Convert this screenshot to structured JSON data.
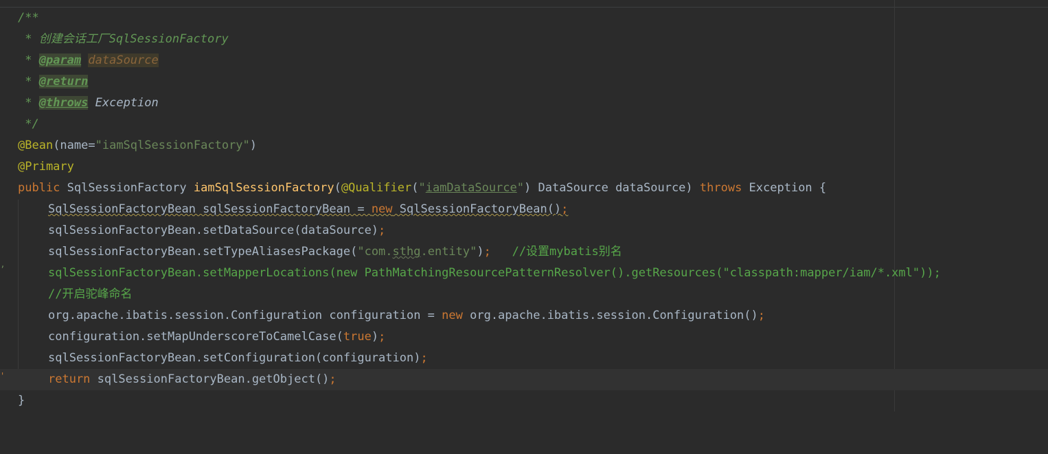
{
  "editor": {
    "language": "java",
    "gutter_marks": {
      "mapper_line_mark": "ʼ",
      "return_line_mark": "'"
    },
    "lines": {
      "l1": "/**",
      "l2_prefix": " * ",
      "l2_text": "创建会话工厂SqlSessionFactory",
      "l3_prefix": " * ",
      "l3_tag": "@param",
      "l3_param": "dataSource",
      "l4_prefix": " * ",
      "l4_tag": "@return",
      "l5_prefix": " * ",
      "l5_tag": "@throws",
      "l5_ref": "Exception",
      "l6": " */",
      "l7_ann": "@Bean",
      "l7_open": "(name=",
      "l7_str": "\"iamSqlSessionFactory\"",
      "l7_close": ")",
      "l8_ann": "@Primary",
      "l9_kw1": "public",
      "l9_type": " SqlSessionFactory ",
      "l9_fn": "iamSqlSessionFactory",
      "l9_open": "(",
      "l9_ann": "@Qualifier",
      "l9_p1": "(",
      "l9_q1": "\"",
      "l9_str": "iamDataSource",
      "l9_q2": "\"",
      "l9_rest": ") DataSource dataSource) ",
      "l9_kw2": "throws",
      "l9_end": " Exception {",
      "l10_decl": "SqlSessionFactoryBean sqlSessionFactoryBean = ",
      "l10_new": "new",
      "l10_ctor": " SqlSessionFactoryBean()",
      "l10_semi": ";",
      "l11_code": "sqlSessionFactoryBean.setDataSource(dataSource)",
      "l11_semi": ";",
      "l12_code": "sqlSessionFactoryBean.setTypeAliasesPackage(",
      "l12_str1": "\"com.",
      "l12_str2": "sthg",
      "l12_str3": ".entity\"",
      "l12_close": ")",
      "l12_semi": ";",
      "l12_cmt": "   //设置mybatis别名",
      "l13_code": "sqlSessionFactoryBean.setMapperLocations(new PathMatchingResourcePatternResolver().getResources(\"classpath:mapper/iam/*.xml\"));",
      "l14_cmt": "//开启驼峰命名",
      "l15_code1": "org.apache.ibatis.session.Configuration configuration = ",
      "l15_new": "new",
      "l15_code2": " org.apache.ibatis.session.Configuration()",
      "l15_semi": ";",
      "l16_code": "configuration.setMapUnderscoreToCamelCase(",
      "l16_kw": "true",
      "l16_close": ")",
      "l16_semi": ";",
      "l17_code": "sqlSessionFactoryBean.setConfiguration(configuration)",
      "l17_semi": ";",
      "l18_kw": "return",
      "l18_code": " sqlSessionFactoryBean.getObject()",
      "l18_semi": ";",
      "l19": "}"
    }
  },
  "colors": {
    "background": "#2b2b2b",
    "current_line": "#323232",
    "keyword": "#cc7832",
    "string": "#6a8759",
    "annotation": "#bbb529",
    "method_declaration": "#ffc66d",
    "doc_comment": "#629755",
    "plain": "#a9b7c6"
  }
}
